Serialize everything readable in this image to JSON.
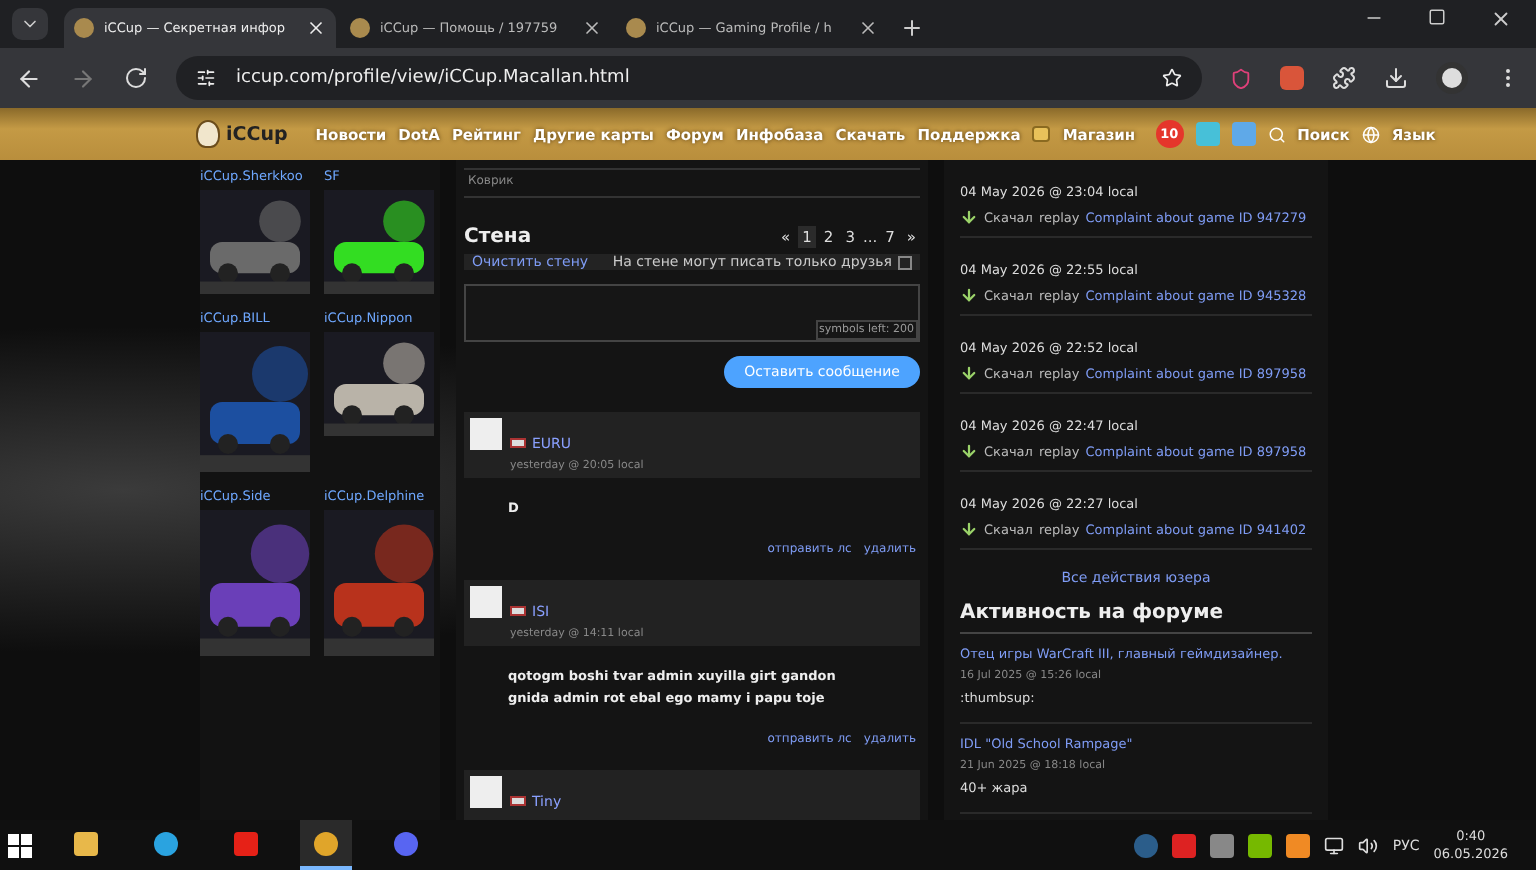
{
  "browser": {
    "tabs": [
      {
        "title": "iCCup — Секретная инфор",
        "selected": true
      },
      {
        "title": "iCCup — Помощь / 197759",
        "selected": false
      },
      {
        "title": "iCCup — Gaming Profile / h",
        "selected": false
      }
    ],
    "url": "iccup.com/profile/view/iCCup.Macallan.html"
  },
  "nav": {
    "logo": "iCCup",
    "items": [
      "Новости",
      "DotA",
      "Рейтинг",
      "Другие карты",
      "Форум",
      "Инфобаза",
      "Скачать",
      "Поддержка"
    ],
    "shop": "Магазин",
    "badge": "10",
    "search": "Поиск",
    "language": "Язык"
  },
  "friends": [
    {
      "name": "iCCup.Sherkkoo"
    },
    {
      "name": "SF"
    },
    {
      "name": "iCCup.BILL"
    },
    {
      "name": "iCCup.Nippon"
    },
    {
      "name": "iCCup.Side"
    },
    {
      "name": "iCCup.Delphine"
    }
  ],
  "wall": {
    "section_label": "Коврик",
    "title": "Стена",
    "prev": "«",
    "next": "»",
    "pages": [
      {
        "kind": "page",
        "label": "1",
        "selected": true
      },
      {
        "kind": "page",
        "label": "2",
        "selected": false
      },
      {
        "kind": "page",
        "label": "3",
        "selected": false
      },
      {
        "kind": "gap",
        "label": "..."
      },
      {
        "kind": "page",
        "label": "7",
        "selected": false
      }
    ],
    "clear": "Очистить стену",
    "friends_only": {
      "label": "На стене могут писать только друзья",
      "checked": false
    },
    "counter": "symbols left: 200",
    "submit": "Оставить сообщение",
    "comments": [
      {
        "author": "EURU",
        "time": "yesterday @ 20:05 local",
        "text": "D",
        "actions": [
          "отправить лс",
          "удалить"
        ]
      },
      {
        "author": "ISI",
        "time": "yesterday @ 14:11 local",
        "text": "qotogm boshi tvar admin xuyilla girt gandon gnida admin rot ebal ego mamy i papu toje",
        "actions": [
          "отправить лс",
          "удалить"
        ]
      },
      {
        "author": "Tiny"
      }
    ]
  },
  "activity": [
    {
      "date": "04 May 2026 @ 23:04 local",
      "action": "Скачал",
      "object": "replay",
      "link": "Complaint about game ID 947279"
    },
    {
      "date": "04 May 2026 @ 22:55 local",
      "action": "Скачал",
      "object": "replay",
      "link": "Complaint about game ID 945328"
    },
    {
      "date": "04 May 2026 @ 22:52 local",
      "action": "Скачал",
      "object": "replay",
      "link": "Complaint about game ID 897958"
    },
    {
      "date": "04 May 2026 @ 22:47 local",
      "action": "Скачал",
      "object": "replay",
      "link": "Complaint about game ID 897958"
    },
    {
      "date": "04 May 2026 @ 22:27 local",
      "action": "Скачал",
      "object": "replay",
      "link": "Complaint about game ID 941402"
    }
  ],
  "all_actions": "Все действия юзера",
  "forum": {
    "title": "Активность на форуме",
    "posts": [
      {
        "topic": "Отец игры WarCraft III, главный геймдизайнер.",
        "date": "16 Jul 2025 @ 15:26 local",
        "text": ":thumbsup:"
      },
      {
        "topic": "IDL \"Old School Rampage\"",
        "date": "21 Jun 2025 @ 18:18 local",
        "text": "40+ жара"
      }
    ]
  },
  "taskbar": {
    "language": "РУС",
    "time": "0:40",
    "date": "06.05.2026"
  }
}
